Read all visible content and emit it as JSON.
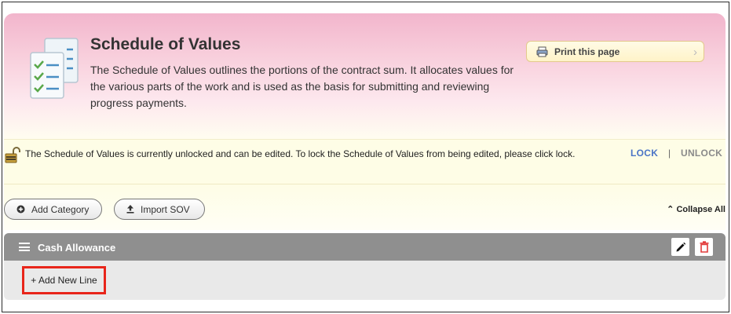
{
  "header": {
    "title": "Schedule of Values",
    "description": "The Schedule of Values outlines the portions of the contract sum. It allocates values for the various parts of the work and is used as the basis for submitting and reviewing progress payments.",
    "print_label": "Print this page",
    "icon": "document-checklist-icon"
  },
  "lock_bar": {
    "message": "The Schedule of Values is currently unlocked and can be edited. To lock the Schedule of Values from being edited, please click lock.",
    "lock_label": "LOCK",
    "separator": "|",
    "unlock_label": "UNLOCK",
    "icon": "unlocked-padlock-icon"
  },
  "toolbar": {
    "add_category_label": "Add Category",
    "import_sov_label": "Import SOV",
    "collapse_all_label": "Collapse All"
  },
  "categories": [
    {
      "name": "Cash Allowance",
      "add_line_label": "+ Add New Line"
    }
  ],
  "colors": {
    "header_gradient_top": "#f2b5cc",
    "lockbar_bg": "#fefde6",
    "category_header": "#8f8f8f",
    "lock_link": "#4a74c6",
    "delete_red": "#e23b3b",
    "highlight_box": "#e8251a"
  }
}
